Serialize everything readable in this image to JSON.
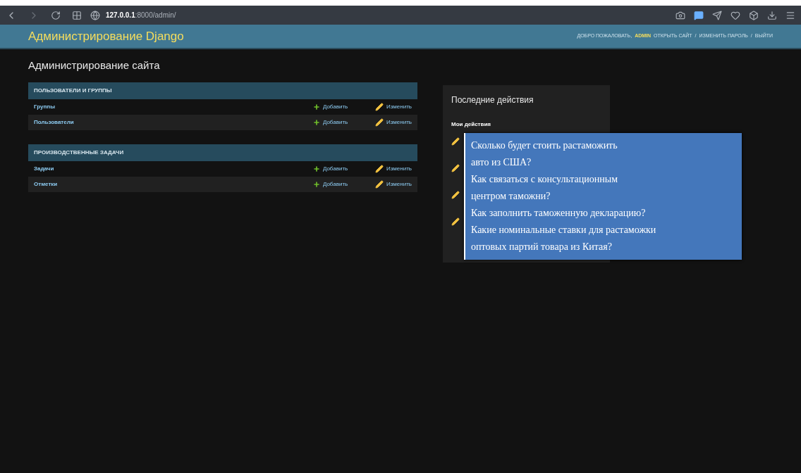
{
  "browser": {
    "url_host": "127.0.0.1",
    "url_rest": ":8000/admin/"
  },
  "header": {
    "title": "Администрирование Django",
    "welcome": "ДОБРО ПОЖАЛОВАТЬ,",
    "user": "ADMIN",
    "links": [
      {
        "text": "ОТКРЫТЬ САЙТ"
      },
      {
        "separator": "/",
        "text": "ИЗМЕНИТЬ ПАРОЛЬ"
      },
      {
        "separator": "/",
        "text": "ВЫЙТИ"
      }
    ]
  },
  "page_title": "Администрирование сайта",
  "modules": [
    {
      "caption": "ПОЛЬЗОВАТЕЛИ И ГРУППЫ",
      "rows": [
        {
          "name": "Группы",
          "add": "Добавить",
          "change": "Изменить"
        },
        {
          "name": "Пользователи",
          "add": "Добавить",
          "change": "Изменить"
        }
      ]
    },
    {
      "caption": "ПРОИЗВОДСТВЕННЫЕ ЗАДАЧИ",
      "rows": [
        {
          "name": "Задачи",
          "add": "Добавить",
          "change": "Изменить"
        },
        {
          "name": "Отметки",
          "add": "Добавить",
          "change": "Изменить"
        }
      ]
    }
  ],
  "recent": {
    "title": "Последние действия",
    "subtitle": "Мои действия",
    "items": [
      {
        "kind": "change"
      },
      {
        "kind": "change"
      },
      {
        "kind": "change"
      },
      {
        "kind": "change"
      }
    ]
  },
  "overlay": {
    "lines": [
      "Сколько будет стоить растаможить",
      "авто из США?",
      "Как связаться с консультационным",
      "центром таможни?",
      "Как заполнить таможенную декларацию?",
      "Какие номинальные ставки для растаможки",
      "оптовых партий товара из Китая?"
    ]
  }
}
